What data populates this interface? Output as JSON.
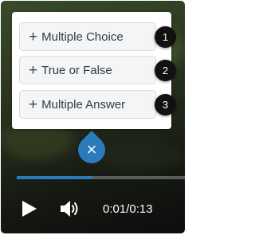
{
  "options": [
    {
      "label": "Multiple Choice",
      "badge": "1"
    },
    {
      "label": "True or False",
      "badge": "2"
    },
    {
      "label": "Multiple Answer",
      "badge": "3"
    }
  ],
  "marker_symbol": "×",
  "player": {
    "time": "0:01/0:13",
    "progress": 0.45
  },
  "icons": {
    "option_plus": "+",
    "play": "play-icon",
    "volume": "volume-icon",
    "close": "close-icon"
  },
  "colors": {
    "accent": "#2b7abc",
    "badge": "#111111",
    "option_bg": "#f4f5f6",
    "text": "#2d3b45"
  }
}
